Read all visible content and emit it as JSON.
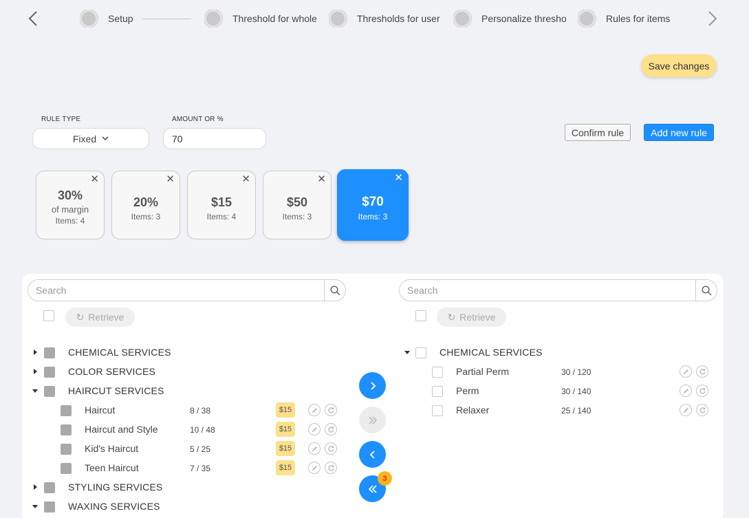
{
  "stepper": {
    "steps": [
      {
        "label": "Setup"
      },
      {
        "label": "Threshold for whole"
      },
      {
        "label": "Thresholds for user"
      },
      {
        "label": "Personalize threshold"
      },
      {
        "label": "Rules for items"
      }
    ]
  },
  "toolbar": {
    "save_label": "Save changes"
  },
  "rule_form": {
    "rule_type_label": "RULE TYPE",
    "rule_type_value": "Fixed",
    "amount_label": "AMOUNT OR %",
    "amount_value": "70",
    "confirm_label": "Confirm rule",
    "add_label": "Add new rule"
  },
  "rules": [
    {
      "amount": "30%",
      "sub": "of margin",
      "items": "Items: 4",
      "active": false
    },
    {
      "amount": "20%",
      "sub": "",
      "items": "Items: 3",
      "active": false
    },
    {
      "amount": "$15",
      "sub": "",
      "items": "Items: 4",
      "active": false
    },
    {
      "amount": "$50",
      "sub": "",
      "items": "Items: 3",
      "active": false
    },
    {
      "amount": "$70",
      "sub": "",
      "items": "Items: 3",
      "active": true
    }
  ],
  "left": {
    "search_placeholder": "Search",
    "retrieve_label": "Retrieve",
    "categories": [
      {
        "label": "CHEMICAL SERVICES",
        "expanded": false
      },
      {
        "label": "COLOR SERVICES",
        "expanded": false
      },
      {
        "label": "HAIRCUT SERVICES",
        "expanded": true
      },
      {
        "label": "STYLING SERVICES",
        "expanded": false
      },
      {
        "label": "WAXING SERVICES",
        "expanded": true
      }
    ],
    "items": [
      {
        "name": "Haircut",
        "qty": "8  /  38",
        "badge": "$15"
      },
      {
        "name": "Haircut and Style",
        "qty": "10  /  48",
        "badge": "$15"
      },
      {
        "name": "Kid's Haircut",
        "qty": "5  /  25",
        "badge": "$15"
      },
      {
        "name": "Teen Haircut",
        "qty": "7  /  35",
        "badge": "$15"
      }
    ]
  },
  "right": {
    "search_placeholder": "Search",
    "retrieve_label": "Retrieve",
    "category": "CHEMICAL SERVICES",
    "items": [
      {
        "name": "Partial Perm",
        "qty": "30  /  120"
      },
      {
        "name": "Perm",
        "qty": "30  /  140"
      },
      {
        "name": "Relaxer",
        "qty": "25  /  140"
      }
    ]
  },
  "transfer": {
    "selected_count": "3"
  },
  "colors": {
    "accent": "#1d8fff",
    "highlight": "#fde08a",
    "badge": "#ffb21a"
  }
}
